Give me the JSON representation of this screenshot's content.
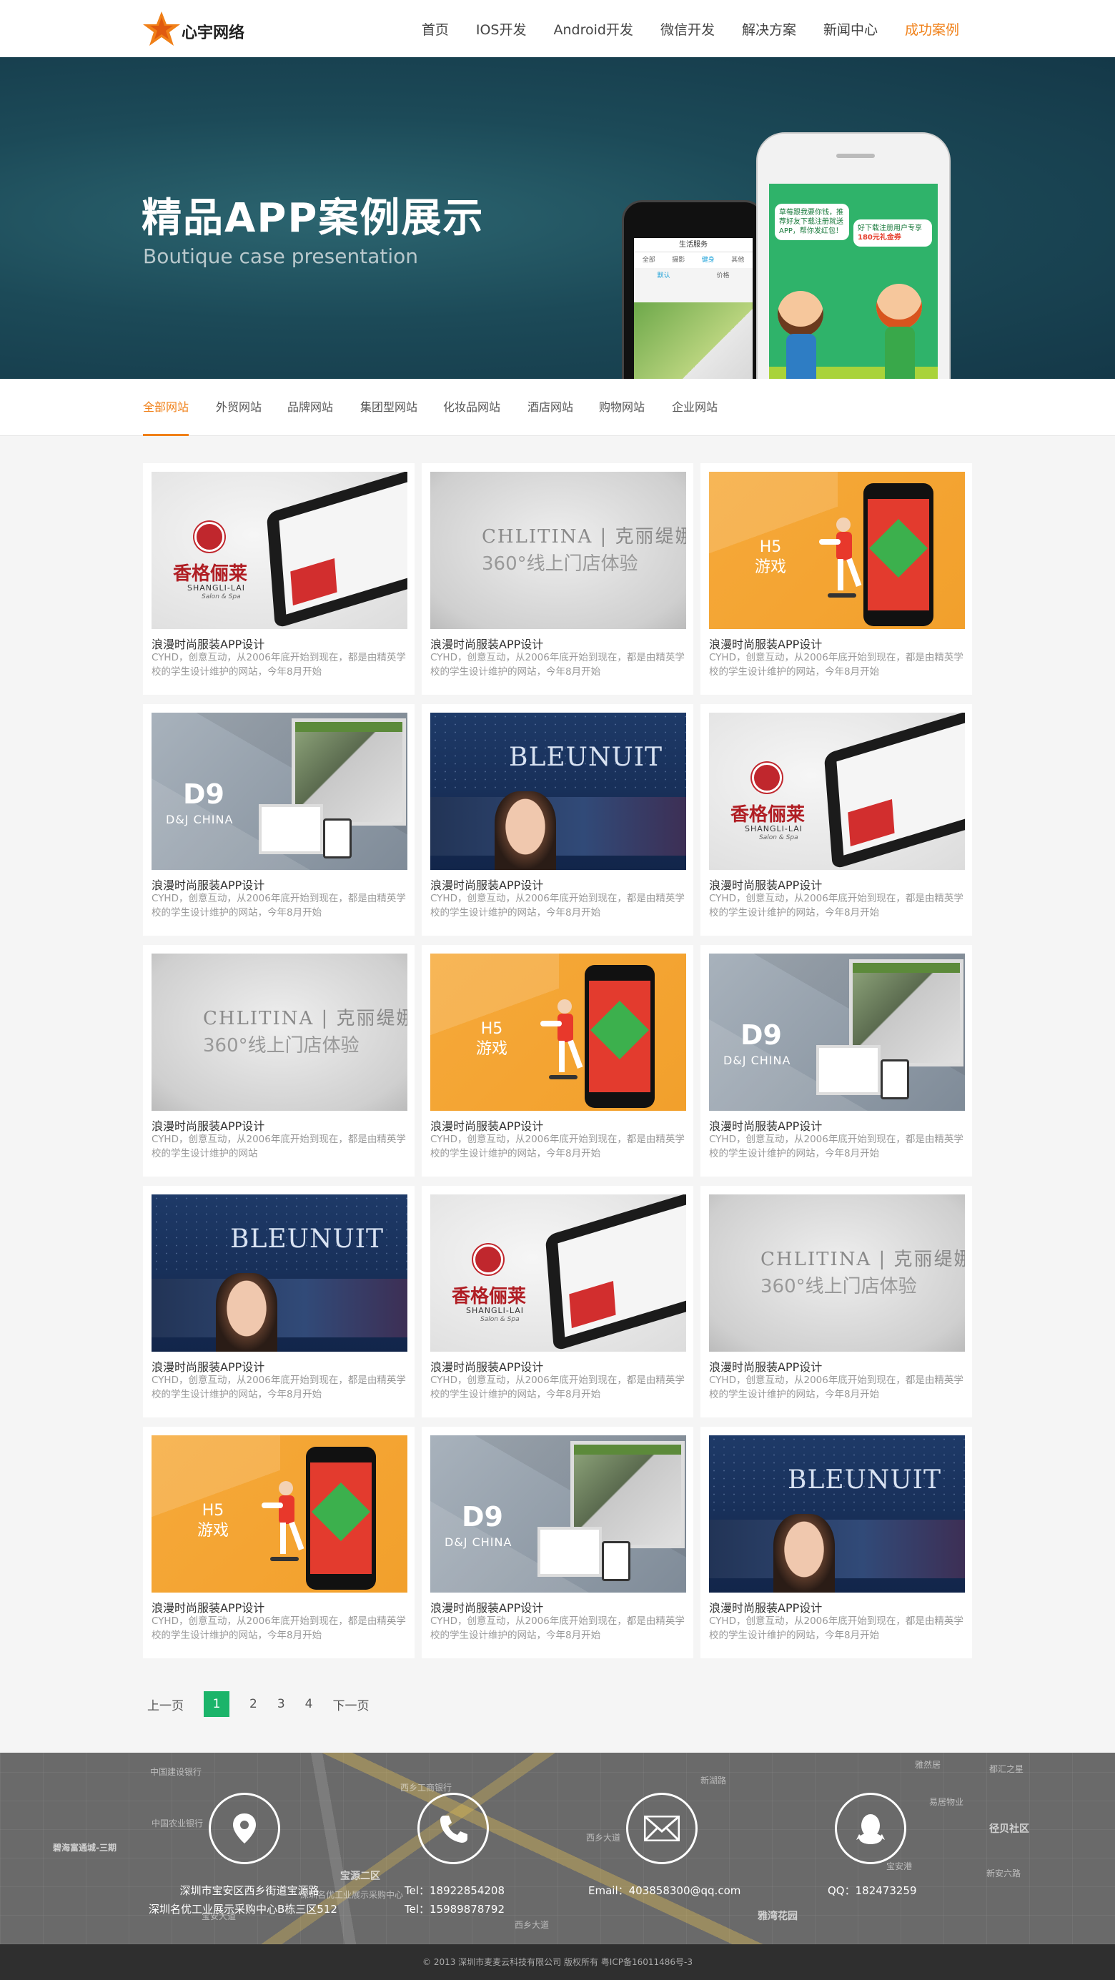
{
  "header": {
    "logo_text": "心宇网络",
    "nav": [
      "首页",
      "IOS开发",
      "Android开发",
      "微信开发",
      "解决方案",
      "新闻中心",
      "成功案例"
    ],
    "active_nav": "成功案例",
    "accent_color": "#f08018"
  },
  "banner": {
    "title": "精品APP案例展示",
    "subtitle": "Boutique case presentation",
    "phone_back": {
      "header": "生活服务",
      "tabs": [
        "全部",
        "摄影",
        "健身",
        "其他"
      ],
      "subtabs": [
        "默认",
        "价格"
      ]
    },
    "phone_front": {
      "bubble_left": "草莓跟我要你钱，推荐好友下载注册就送APP，帮你发红包！",
      "bubble_right": "好下载注册用户专享",
      "bubble_right_highlight": "180元礼金券"
    }
  },
  "filters": [
    "全部网站",
    "外贸网站",
    "品牌网站",
    "集团型网站",
    "化妆品网站",
    "酒店网站",
    "购物网站",
    "企业网站"
  ],
  "active_filter": "全部网站",
  "cases": [
    {
      "thumb": "shangli",
      "title": "浪漫时尚服装APP设计",
      "desc": "CYHD，创意互动，从2006年底开始到现在，都是由精英学校的学生设计维护的网站，今年8月开始"
    },
    {
      "thumb": "chlitina",
      "title": "浪漫时尚服装APP设计",
      "desc": "CYHD，创意互动，从2006年底开始到现在，都是由精英学校的学生设计维护的网站，今年8月开始"
    },
    {
      "thumb": "h5",
      "title": "浪漫时尚服装APP设计",
      "desc": "CYHD，创意互动，从2006年底开始到现在，都是由精英学校的学生设计维护的网站，今年8月开始"
    },
    {
      "thumb": "dj",
      "title": "浪漫时尚服装APP设计",
      "desc": "CYHD，创意互动，从2006年底开始到现在，都是由精英学校的学生设计维护的网站，今年8月开始"
    },
    {
      "thumb": "bleunuit",
      "title": "浪漫时尚服装APP设计",
      "desc": "CYHD，创意互动，从2006年底开始到现在，都是由精英学校的学生设计维护的网站，今年8月开始"
    },
    {
      "thumb": "shangli",
      "title": "浪漫时尚服装APP设计",
      "desc": "CYHD，创意互动，从2006年底开始到现在，都是由精英学校的学生设计维护的网站，今年8月开始"
    },
    {
      "thumb": "chlitina",
      "title": "浪漫时尚服装APP设计",
      "desc": "CYHD，创意互动，从2006年底开始到现在，都是由精英学校的学生设计维护的网站"
    },
    {
      "thumb": "h5",
      "title": "浪漫时尚服装APP设计",
      "desc": "CYHD，创意互动，从2006年底开始到现在，都是由精英学校的学生设计维护的网站，今年8月开始"
    },
    {
      "thumb": "dj",
      "title": "浪漫时尚服装APP设计",
      "desc": "CYHD，创意互动，从2006年底开始到现在，都是由精英学校的学生设计维护的网站，今年8月开始"
    },
    {
      "thumb": "bleunuit",
      "title": "浪漫时尚服装APP设计",
      "desc": "CYHD，创意互动，从2006年底开始到现在，都是由精英学校的学生设计维护的网站，今年8月开始"
    },
    {
      "thumb": "shangli",
      "title": "浪漫时尚服装APP设计",
      "desc": "CYHD，创意互动，从2006年底开始到现在，都是由精英学校的学生设计维护的网站，今年8月开始"
    },
    {
      "thumb": "chlitina",
      "title": "浪漫时尚服装APP设计",
      "desc": "CYHD，创意互动，从2006年底开始到现在，都是由精英学校的学生设计维护的网站，今年8月开始"
    },
    {
      "thumb": "h5",
      "title": "浪漫时尚服装APP设计",
      "desc": "CYHD，创意互动，从2006年底开始到现在，都是由精英学校的学生设计维护的网站，今年8月开始"
    },
    {
      "thumb": "dj",
      "title": "浪漫时尚服装APP设计",
      "desc": "CYHD，创意互动，从2006年底开始到现在，都是由精英学校的学生设计维护的网站，今年8月开始"
    },
    {
      "thumb": "bleunuit",
      "title": "浪漫时尚服装APP设计",
      "desc": "CYHD，创意互动，从2006年底开始到现在，都是由精英学校的学生设计维护的网站，今年8月开始"
    }
  ],
  "thumb_text": {
    "shangli_cn": "香格俪莱",
    "shangli_en": "SHANGLI-LAI",
    "shangli_sub": "Salon & Spa",
    "chlitina_line1": "CHLITINA | 克丽缇娜",
    "chlitina_line2": "360°线上门店体验",
    "h5_line1": "H5",
    "h5_line2": "游戏",
    "dj_mark": "D9",
    "dj_text": "D&J CHINA",
    "bleunuit_logo": "BLEUNUIT"
  },
  "pagination": {
    "prev": "上一页",
    "pages": [
      "1",
      "2",
      "3",
      "4"
    ],
    "current": "1",
    "next": "下一页",
    "current_color": "#1bb46a"
  },
  "footer": {
    "address_line1": "深圳市宝安区西乡街道宝源路",
    "address_line2": "深圳名优工业展示采购中心B栋三区512",
    "tel1": "Tel：18922854208",
    "tel2": "Tel：15989878792",
    "email": "Email：403858300@qq.com",
    "qq": "QQ：182473259",
    "icons": [
      "location-icon",
      "phone-icon",
      "mail-icon",
      "qq-icon"
    ],
    "map_labels": [
      "中国建设银行",
      "西乡工商银行",
      "中国农业银行",
      "碧海富通城-三期",
      "宝源二区",
      "雅湾花园",
      "径贝社区",
      "都汇之星",
      "易居物业",
      "西乡大道",
      "新湖路",
      "宝安大道",
      "新安六路",
      "宝安港",
      "雅然居",
      "西乡大道",
      "深圳名优工业展示采购中心"
    ]
  },
  "copyright": "© 2013 深圳市麦麦云科技有限公司 版权所有 粤ICP备16011486号-3"
}
